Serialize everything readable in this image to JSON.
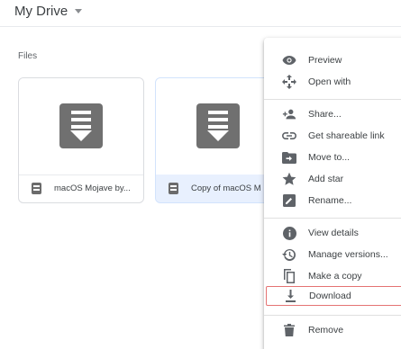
{
  "header": {
    "title": "My Drive"
  },
  "files_section": {
    "label": "Files"
  },
  "files": [
    {
      "name": "macOS Mojave by...",
      "selected": false
    },
    {
      "name": "Copy of macOS M",
      "selected": true
    }
  ],
  "context_menu": {
    "items": [
      {
        "label": "Preview",
        "icon": "eye-icon"
      },
      {
        "label": "Open with",
        "icon": "open-with-icon"
      },
      {
        "label": "Share...",
        "icon": "add-person-icon"
      },
      {
        "label": "Get shareable link",
        "icon": "link-icon"
      },
      {
        "label": "Move to...",
        "icon": "move-to-folder-icon"
      },
      {
        "label": "Add star",
        "icon": "star-icon"
      },
      {
        "label": "Rename...",
        "icon": "rename-icon"
      },
      {
        "label": "View details",
        "icon": "info-icon"
      },
      {
        "label": "Manage versions...",
        "icon": "history-icon"
      },
      {
        "label": "Make a copy",
        "icon": "copy-icon"
      },
      {
        "label": "Download",
        "icon": "download-icon",
        "highlighted": true
      },
      {
        "label": "Remove",
        "icon": "trash-icon"
      }
    ]
  },
  "colors": {
    "icon_gray": "#707070",
    "selected_card_bg": "#e8f0fe",
    "highlight_border": "#e57373"
  }
}
